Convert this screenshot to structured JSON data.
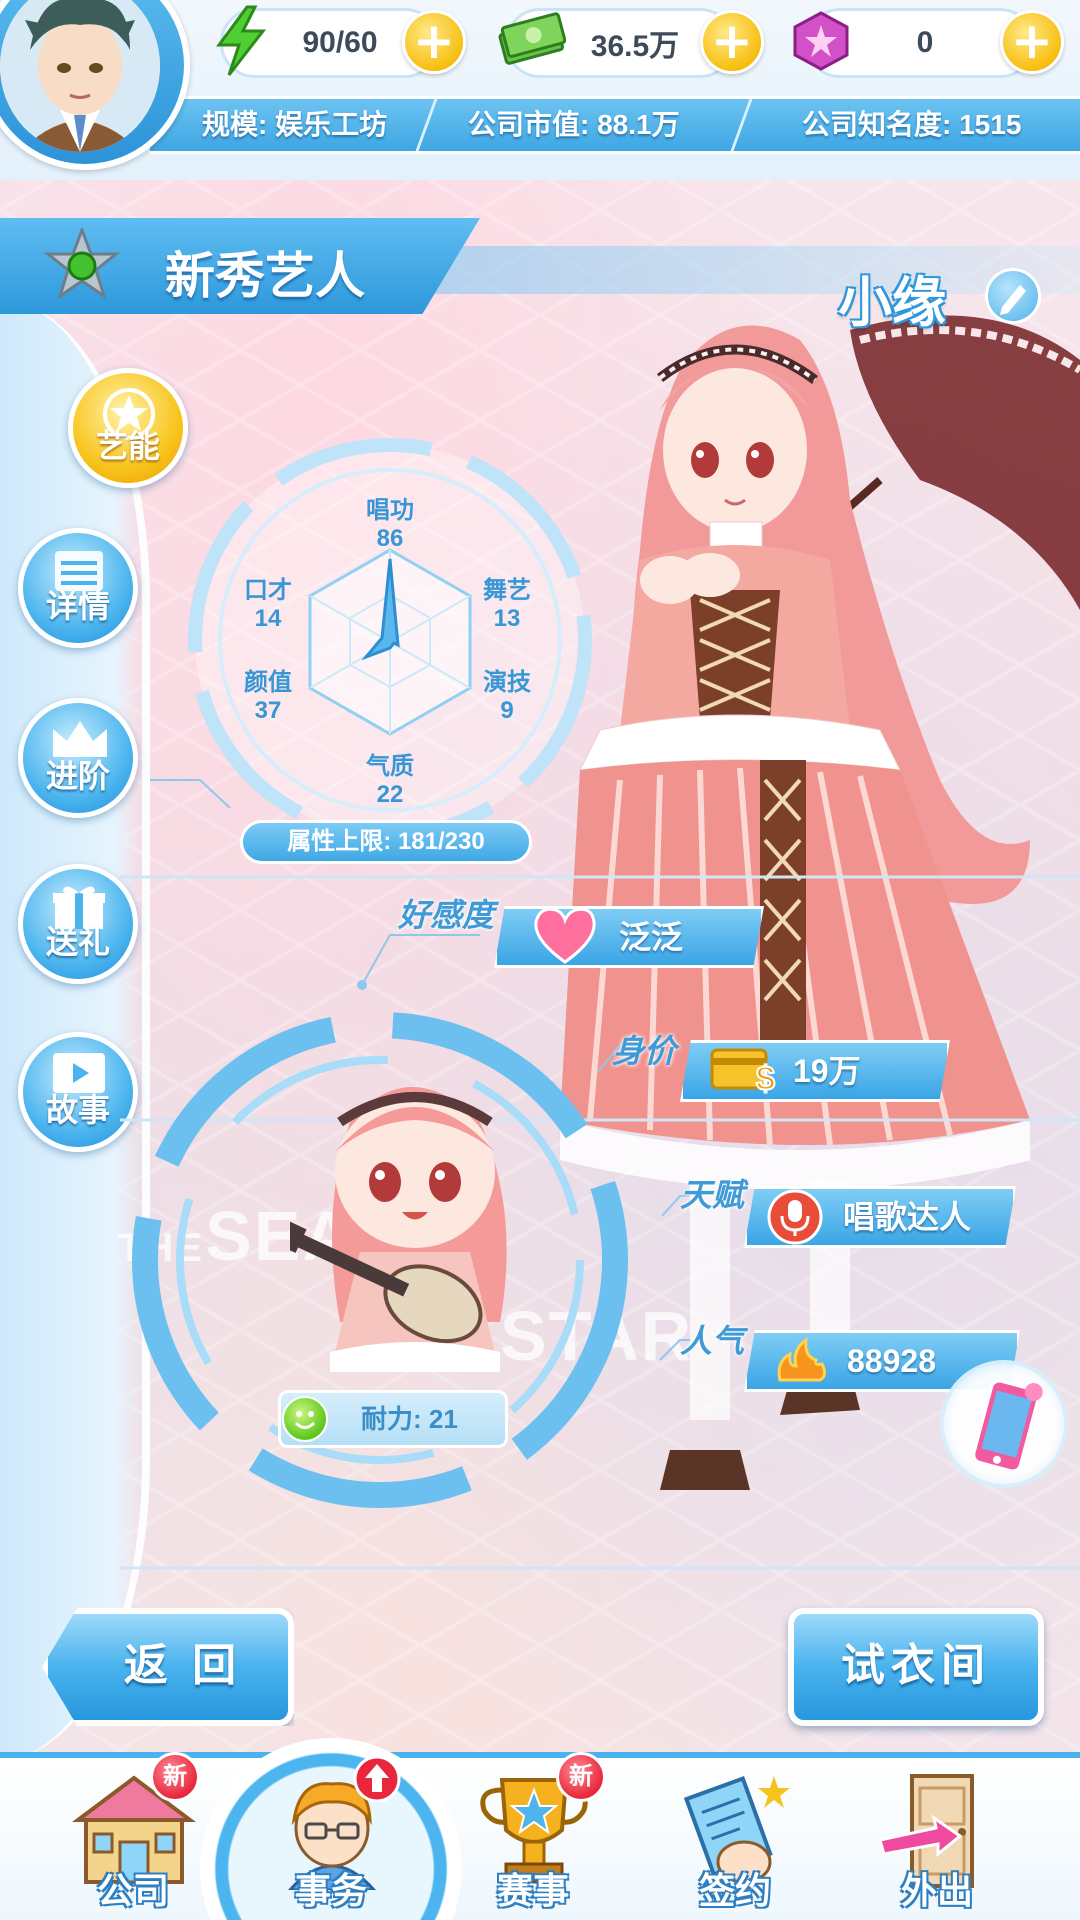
{
  "resources": {
    "energy": "90/60",
    "money": "36.5万",
    "gems": "0"
  },
  "company": {
    "scale": "规模: 娱乐工坊",
    "market_value": "公司市值: 88.1万",
    "fame": "公司知名度: 1515"
  },
  "artist": {
    "rank": "新秀艺人",
    "name": "小缘"
  },
  "side_menu": [
    {
      "label": "艺能",
      "icon": "star-badge-icon"
    },
    {
      "label": "详情",
      "icon": "list-icon"
    },
    {
      "label": "进阶",
      "icon": "crown-icon"
    },
    {
      "label": "送礼",
      "icon": "gift-icon"
    },
    {
      "label": "故事",
      "icon": "play-icon"
    }
  ],
  "stats": {
    "singing": {
      "label": "唱功",
      "value": "86"
    },
    "dance": {
      "label": "舞艺",
      "value": "13"
    },
    "acting": {
      "label": "演技",
      "value": "9"
    },
    "temperament": {
      "label": "气质",
      "value": "22"
    },
    "looks": {
      "label": "颜值",
      "value": "37"
    },
    "eloquence": {
      "label": "口才",
      "value": "14"
    },
    "cap": "属性上限: 181/230"
  },
  "details": {
    "affection_label": "好感度",
    "affection_value": "泛泛",
    "worth_label": "身价",
    "worth_value": "19万",
    "talent_label": "天赋",
    "talent_value": "唱歌达人",
    "popularity_label": "人气",
    "popularity_value": "88928"
  },
  "stamina": "耐力: 21",
  "background_words": {
    "the": "THE",
    "sea": "SEAS",
    "star": "STAR"
  },
  "buttons": {
    "back": "返 回",
    "wardrobe": "试衣间"
  },
  "bottom_nav": [
    {
      "label": "公司",
      "badge": "新",
      "icon": "company-building-icon"
    },
    {
      "label": "事务",
      "badge": "",
      "icon": "manager-icon"
    },
    {
      "label": "赛事",
      "badge": "新",
      "icon": "trophy-icon"
    },
    {
      "label": "签约",
      "badge": "",
      "icon": "contract-icon"
    },
    {
      "label": "外出",
      "badge": "",
      "icon": "door-icon"
    }
  ],
  "colors": {
    "accent_blue": "#3ea6e3",
    "gold": "#f8c31a",
    "badge_red": "#e8273c"
  }
}
